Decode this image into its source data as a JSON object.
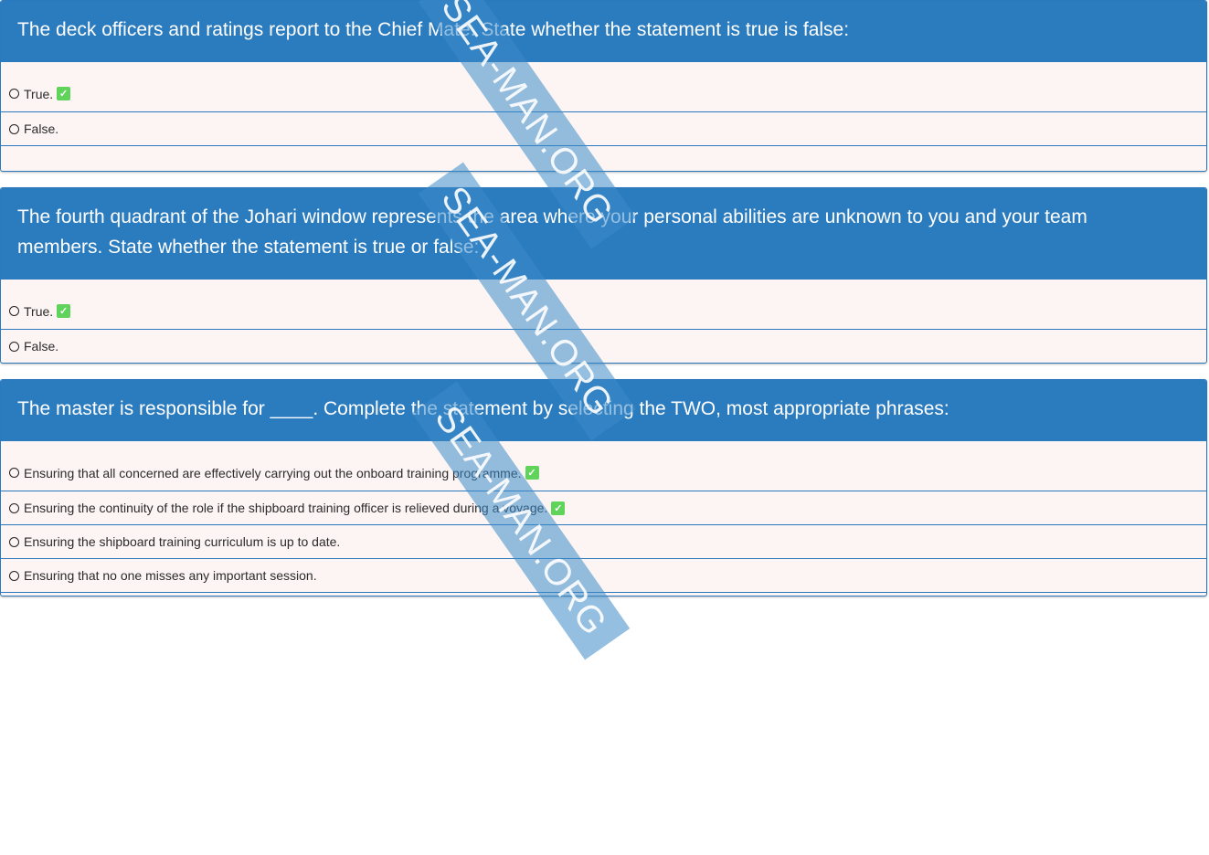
{
  "questions": [
    {
      "text": "The deck officers and ratings report to the Chief Mate. State whether the statement is true is false:",
      "options": [
        {
          "label": "True.",
          "correct": true
        },
        {
          "label": "False.",
          "correct": false
        }
      ]
    },
    {
      "text": "The fourth quadrant of the Johari window represents the area where your personal abilities are unknown to you and your team members. State whether the statement is true or false:",
      "options": [
        {
          "label": "True.",
          "correct": true
        },
        {
          "label": "False.",
          "correct": false
        }
      ]
    },
    {
      "text": "The master is responsible for ____. Complete the statement by selecting the TWO, most appropriate phrases:",
      "options": [
        {
          "label": "Ensuring that all concerned are effectively carrying out the onboard training programme.",
          "correct": true
        },
        {
          "label": "Ensuring the continuity of the role if the shipboard training officer is relieved during a voyage.",
          "correct": true
        },
        {
          "label": "Ensuring the shipboard training curriculum is up to date.",
          "correct": false
        },
        {
          "label": "Ensuring that no one misses any important session.",
          "correct": false
        }
      ]
    }
  ],
  "watermark": {
    "text": "SEA-MAN.ORG"
  },
  "icons": {
    "correct": "checkmark-icon",
    "radio": "radio-button-icon"
  },
  "colors": {
    "header": "#2b7bbf",
    "option_bg": "#fdf5f3",
    "check": "#5fd35a"
  }
}
